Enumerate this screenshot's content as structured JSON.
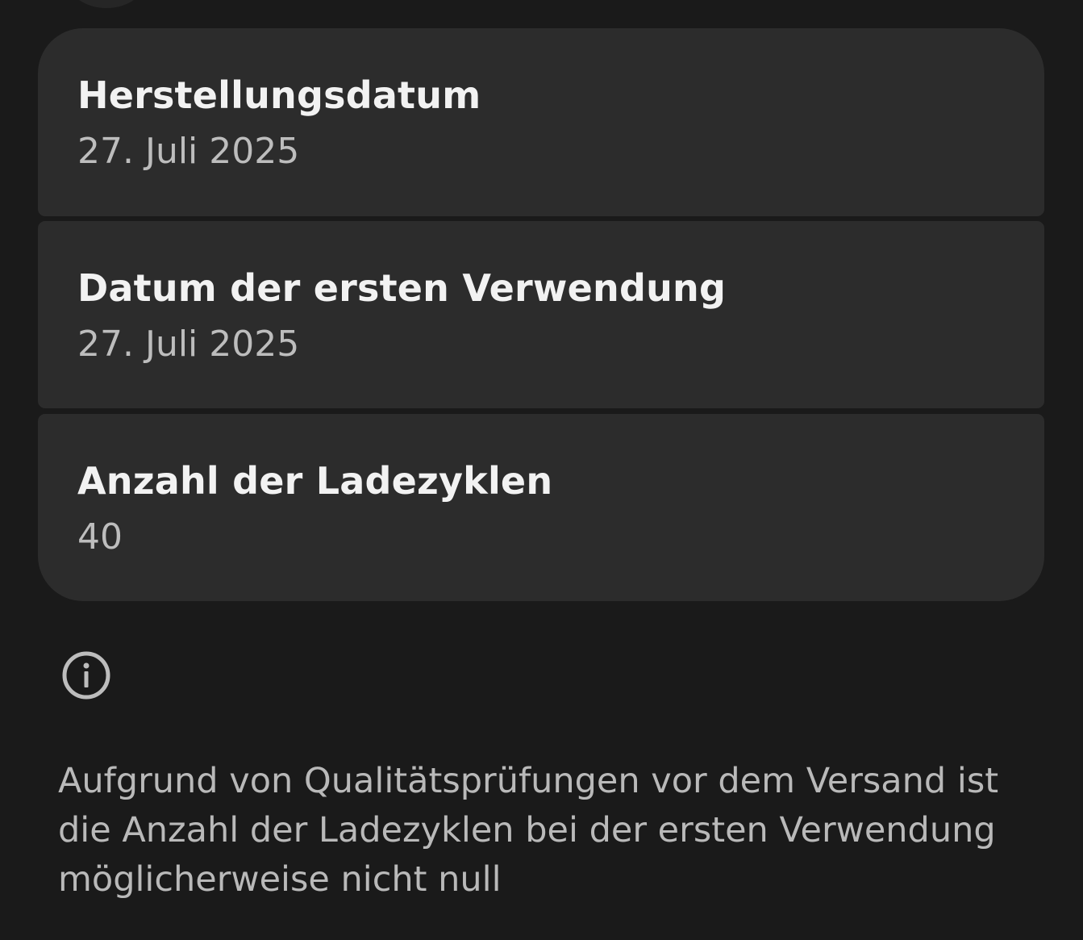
{
  "details": [
    {
      "label": "Herstellungsdatum",
      "value": "27. Juli 2025"
    },
    {
      "label": "Datum der ersten Verwendung",
      "value": "27. Juli 2025"
    },
    {
      "label": "Anzahl der Ladezyklen",
      "value": "40"
    }
  ],
  "info": {
    "icon": "info-icon",
    "text": "Aufgrund von Qualitätsprüfungen vor dem Versand ist die Anzahl der Ladezyklen bei der ersten Verwendung möglicherweise nicht null"
  },
  "colors": {
    "background": "#1a1a1a",
    "card": "#2c2c2c",
    "title_text": "#f2f2f2",
    "secondary_text": "#bdbdbd"
  }
}
